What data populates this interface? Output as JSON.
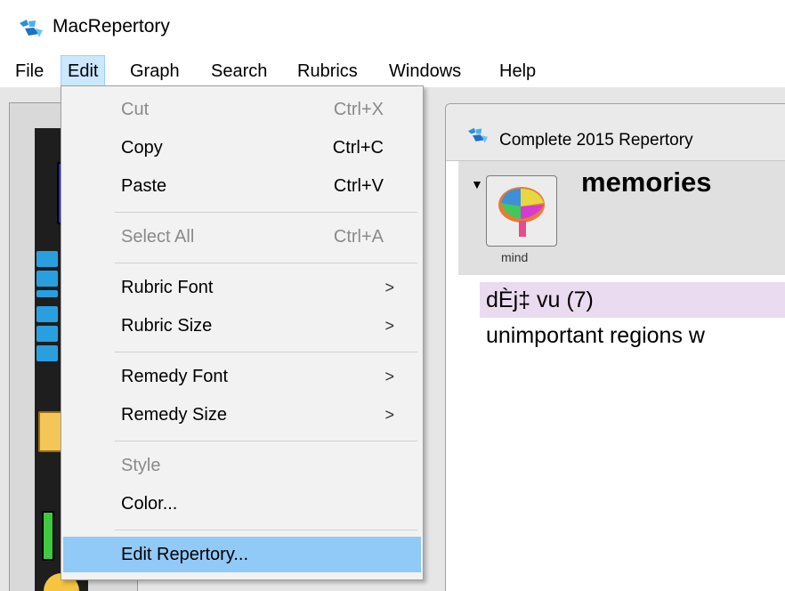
{
  "app": {
    "title": "MacRepertory"
  },
  "menubar": {
    "items": [
      {
        "label": "File",
        "active": false
      },
      {
        "label": "Edit",
        "active": true
      },
      {
        "label": "Graph",
        "active": false
      },
      {
        "label": "Search",
        "active": false
      },
      {
        "label": "Rubrics",
        "active": false
      },
      {
        "label": "Windows",
        "active": false
      },
      {
        "label": "Help",
        "active": false
      }
    ]
  },
  "edit_menu": {
    "items": [
      {
        "label": "Cut",
        "shortcut": "Ctrl+X",
        "enabled": false
      },
      {
        "label": "Copy",
        "shortcut": "Ctrl+C",
        "enabled": true
      },
      {
        "label": "Paste",
        "shortcut": "Ctrl+V",
        "enabled": true
      },
      {
        "label": "Select All",
        "shortcut": "Ctrl+A",
        "enabled": false
      },
      {
        "label": "Rubric Font",
        "submenu": true,
        "enabled": true
      },
      {
        "label": "Rubric Size",
        "submenu": true,
        "enabled": true
      },
      {
        "label": "Remedy Font",
        "submenu": true,
        "enabled": true
      },
      {
        "label": "Remedy Size",
        "submenu": true,
        "enabled": true
      },
      {
        "label": "Style",
        "enabled": false
      },
      {
        "label": "Color...",
        "enabled": true
      },
      {
        "label": "Edit Repertory...",
        "enabled": true,
        "highlighted": true
      }
    ],
    "submenu_arrow": ">"
  },
  "repertory_window": {
    "title": "Complete 2015 Repertory",
    "heading": "memories",
    "chapter_button_label": "mind",
    "expand_glyph": "▼",
    "rubrics": [
      {
        "text": "dÈj‡ vu (7)",
        "selected": true
      },
      {
        "text": "unimportant regions w",
        "selected": false
      }
    ]
  },
  "colors": {
    "menu_active_bg": "#cce8ff",
    "menu_highlight_bg": "#91c9f7",
    "rubric_selected_bg": "#eadbf0",
    "disabled_text": "#8a8a8a"
  }
}
